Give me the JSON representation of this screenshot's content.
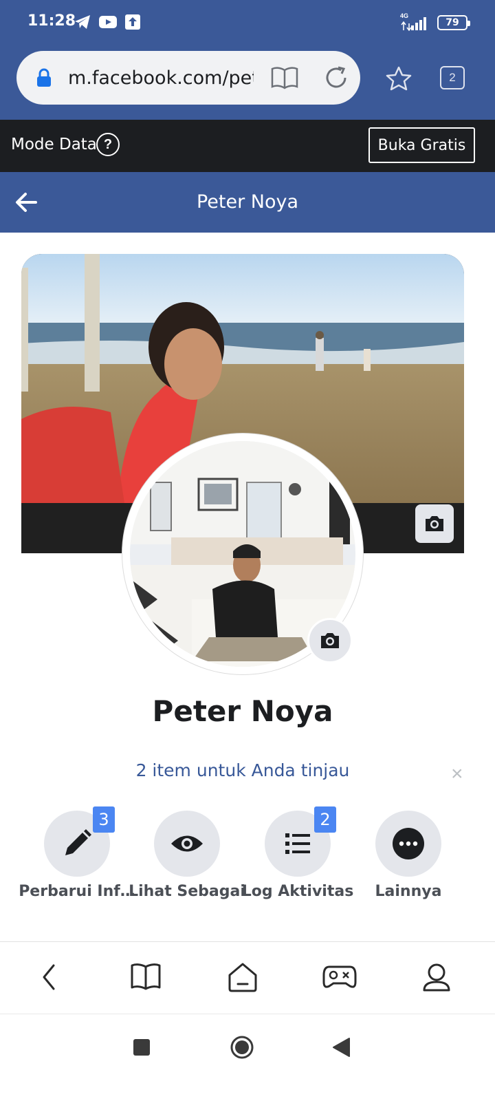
{
  "status_bar": {
    "time": "11:28",
    "network": "4G",
    "battery": "79"
  },
  "browser": {
    "url": "m.facebook.com/pet",
    "tab_count": "2"
  },
  "data_mode": {
    "label": "Mode Data",
    "help_symbol": "?",
    "button": "Buka Gratis"
  },
  "header": {
    "title": "Peter Noya"
  },
  "profile": {
    "name": "Peter Noya"
  },
  "review": {
    "text": "2 item untuk Anda tinjau",
    "close_symbol": "×"
  },
  "actions": [
    {
      "label": "Perbarui Inf…",
      "badge": "3",
      "icon": "pencil-icon"
    },
    {
      "label": "Lihat Sebagai",
      "badge": "",
      "icon": "eye-icon"
    },
    {
      "label": "Log Aktivitas",
      "badge": "2",
      "icon": "list-icon"
    },
    {
      "label": "Lainnya",
      "badge": "",
      "icon": "more-icon"
    }
  ],
  "colors": {
    "facebook_blue": "#3b5998",
    "link_blue": "#385898",
    "badge_blue": "#4b86f2",
    "dark_bar": "#1c1e21"
  }
}
